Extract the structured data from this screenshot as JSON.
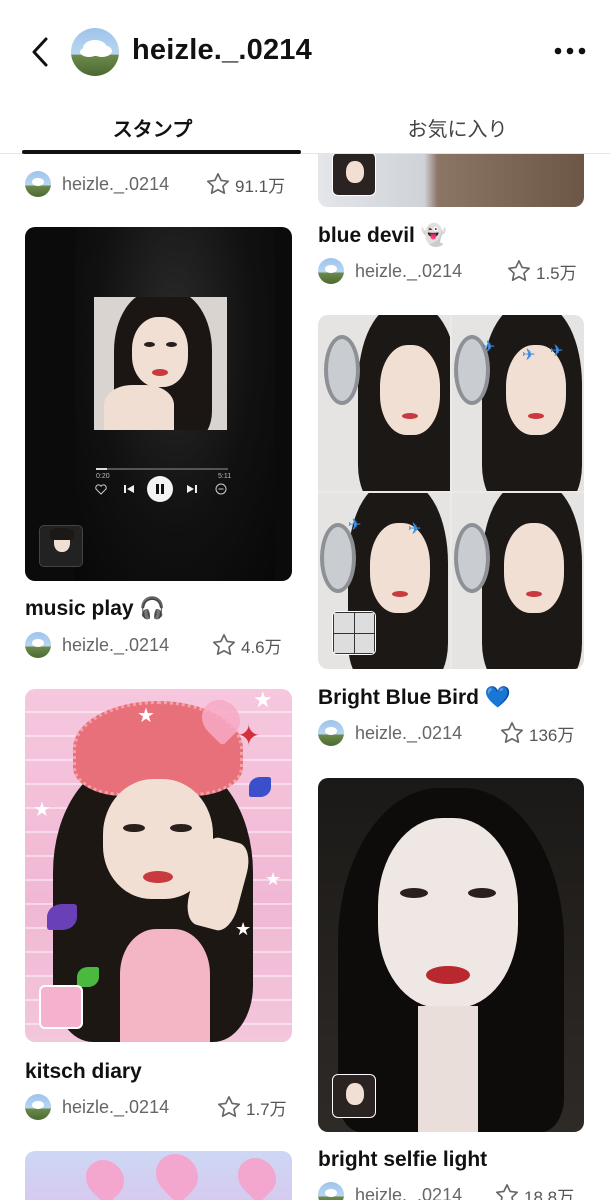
{
  "header": {
    "username": "heizle._.0214"
  },
  "tabs": [
    {
      "label": "スタンプ",
      "active": true
    },
    {
      "label": "お気に入り",
      "active": false
    }
  ],
  "accent_color": "#111111",
  "cards": {
    "partial_top_left": {
      "author": "heizle._.0214",
      "likes": "91.1万"
    },
    "music_play": {
      "title": "music play 🎧",
      "author": "heizle._.0214",
      "likes": "4.6万",
      "player": {
        "elapsed": "0:20",
        "total": "5:11",
        "progress": 0.08
      }
    },
    "kitsch_diary": {
      "title": "kitsch diary",
      "author": "heizle._.0214",
      "likes": "1.7万"
    },
    "blue_devil": {
      "title": "blue devil 👻",
      "author": "heizle._.0214",
      "likes": "1.5万"
    },
    "bright_blue_bird": {
      "title": "Bright Blue Bird 💙",
      "author": "heizle._.0214",
      "likes": "136万"
    },
    "bright_selfie_light": {
      "title": "bright selfie light",
      "author": "heizle._.0214",
      "likes": "18.8万"
    }
  },
  "icons": [
    "back-chevron-icon",
    "more-dots-icon",
    "star-icon",
    "headphones-icon",
    "heart-icon",
    "play-pause-icon"
  ]
}
